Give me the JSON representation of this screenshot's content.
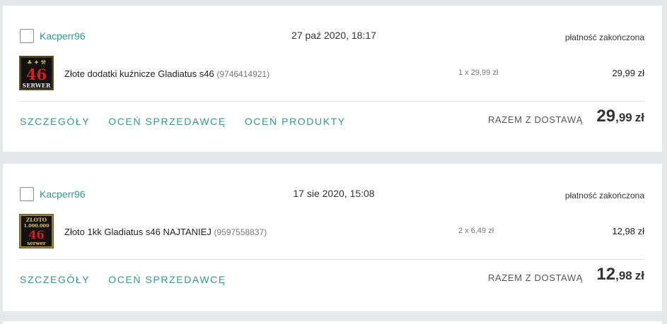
{
  "orders": [
    {
      "seller": "Kacperr96",
      "date": "27 paź 2020, 18:17",
      "status": "płatność zakończona",
      "thumb": {
        "icon": "gold-server-46-thumbnail",
        "top_line": "♣ ✦ ⚒",
        "big": "46",
        "bottom": "SERWER",
        "bg": "#111111",
        "accent": "#d42020"
      },
      "product_title": "Złote dodatki kuźnicze Gladiatus s46",
      "product_id": "(9746414921)",
      "quantity": "1 x 29,99 zł",
      "line_total": "29,99 zł",
      "actions": [
        "SZCZEGÓŁY",
        "OCEŃ SPRZEDAWCĘ",
        "OCEŃ PRODUKTY"
      ],
      "total_label": "RAZEM Z DOSTAWĄ",
      "total_int": "29",
      "total_dec": ",99",
      "total_currency": "zł"
    },
    {
      "seller": "Kacperr96",
      "date": "17 sie 2020, 15:08",
      "status": "płatność zakończona",
      "thumb": {
        "icon": "gold-1kk-server-46-thumbnail",
        "top_line": "ZLOTO",
        "mid": "1.000.000",
        "big": "46",
        "bottom": "serwer",
        "bg": "#111111",
        "accent": "#d42020"
      },
      "product_title": "Złoto 1kk Gladiatus s46 NAJTANIEJ",
      "product_id": "(9597558837)",
      "quantity": "2 x 6,49 zł",
      "line_total": "12,98 zł",
      "actions": [
        "SZCZEGÓŁY",
        "OCEŃ SPRZEDAWCĘ"
      ],
      "total_label": "RAZEM Z DOSTAWĄ",
      "total_int": "12",
      "total_dec": ",98",
      "total_currency": "zł"
    }
  ],
  "colors": {
    "accent": "#2e9a8f",
    "background": "#e6e9ec",
    "card": "#ffffff"
  }
}
